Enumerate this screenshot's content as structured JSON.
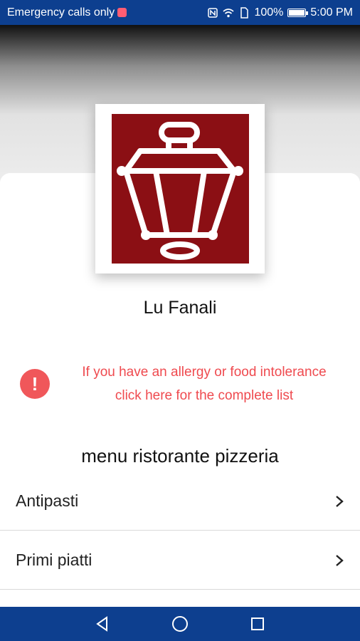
{
  "status_bar": {
    "carrier_text": "Emergency calls only",
    "battery_text": "100%",
    "time": "5:00 PM"
  },
  "restaurant": {
    "name": "Lu Fanali",
    "logo_color": "#8b0f14"
  },
  "allergy_notice": {
    "line1": "If you have an allergy or food intolerance",
    "line2": "click here for the complete list",
    "color": "#ef4a4f"
  },
  "menu": {
    "title": "menu ristorante pizzeria",
    "items": [
      {
        "label": "Antipasti"
      },
      {
        "label": "Primi piatti"
      }
    ]
  },
  "icons": {
    "back": "back-triangle-icon",
    "home": "home-circle-icon",
    "recents": "recents-square-icon"
  }
}
